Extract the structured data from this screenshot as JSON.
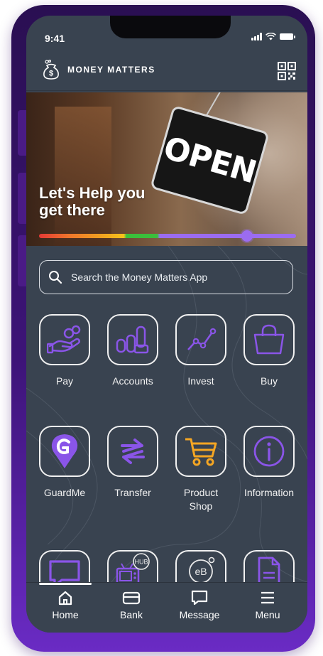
{
  "status": {
    "time": "9:41"
  },
  "app": {
    "name": "MONEY MATTERS"
  },
  "banner": {
    "sign_text": "OPEN",
    "headline_line1": "Let's Help you",
    "headline_line2": "get there",
    "progress_percent": 81
  },
  "search": {
    "placeholder": "Search the Money Matters App"
  },
  "tiles": [
    {
      "label": "Pay",
      "icon": "hand-coins-icon"
    },
    {
      "label": "Accounts",
      "icon": "accounts-icon"
    },
    {
      "label": "Invest",
      "icon": "chart-line-icon"
    },
    {
      "label": "Buy",
      "icon": "shopping-bag-icon"
    },
    {
      "label": "GuardMe",
      "icon": "guardme-pin-icon"
    },
    {
      "label": "Transfer",
      "icon": "transfer-arrows-icon"
    },
    {
      "label_line1": "Product",
      "label_line2": "Shop",
      "icon": "cart-icon"
    },
    {
      "label": "Information",
      "icon": "info-icon"
    },
    {
      "label": "",
      "icon": "chat-icon"
    },
    {
      "label": "",
      "badge": "HUB",
      "icon": "tv-hub-icon"
    },
    {
      "label": "",
      "badge": "eB",
      "icon": "ebill-icon"
    },
    {
      "label": "",
      "icon": "document-icon"
    }
  ],
  "nav": {
    "home": "Home",
    "bank": "Bank",
    "message": "Message",
    "menu": "Menu"
  },
  "colors": {
    "background": "#394350",
    "accent": "#8a55e8",
    "orange": "#f5a623",
    "frame": "#3d1478"
  }
}
